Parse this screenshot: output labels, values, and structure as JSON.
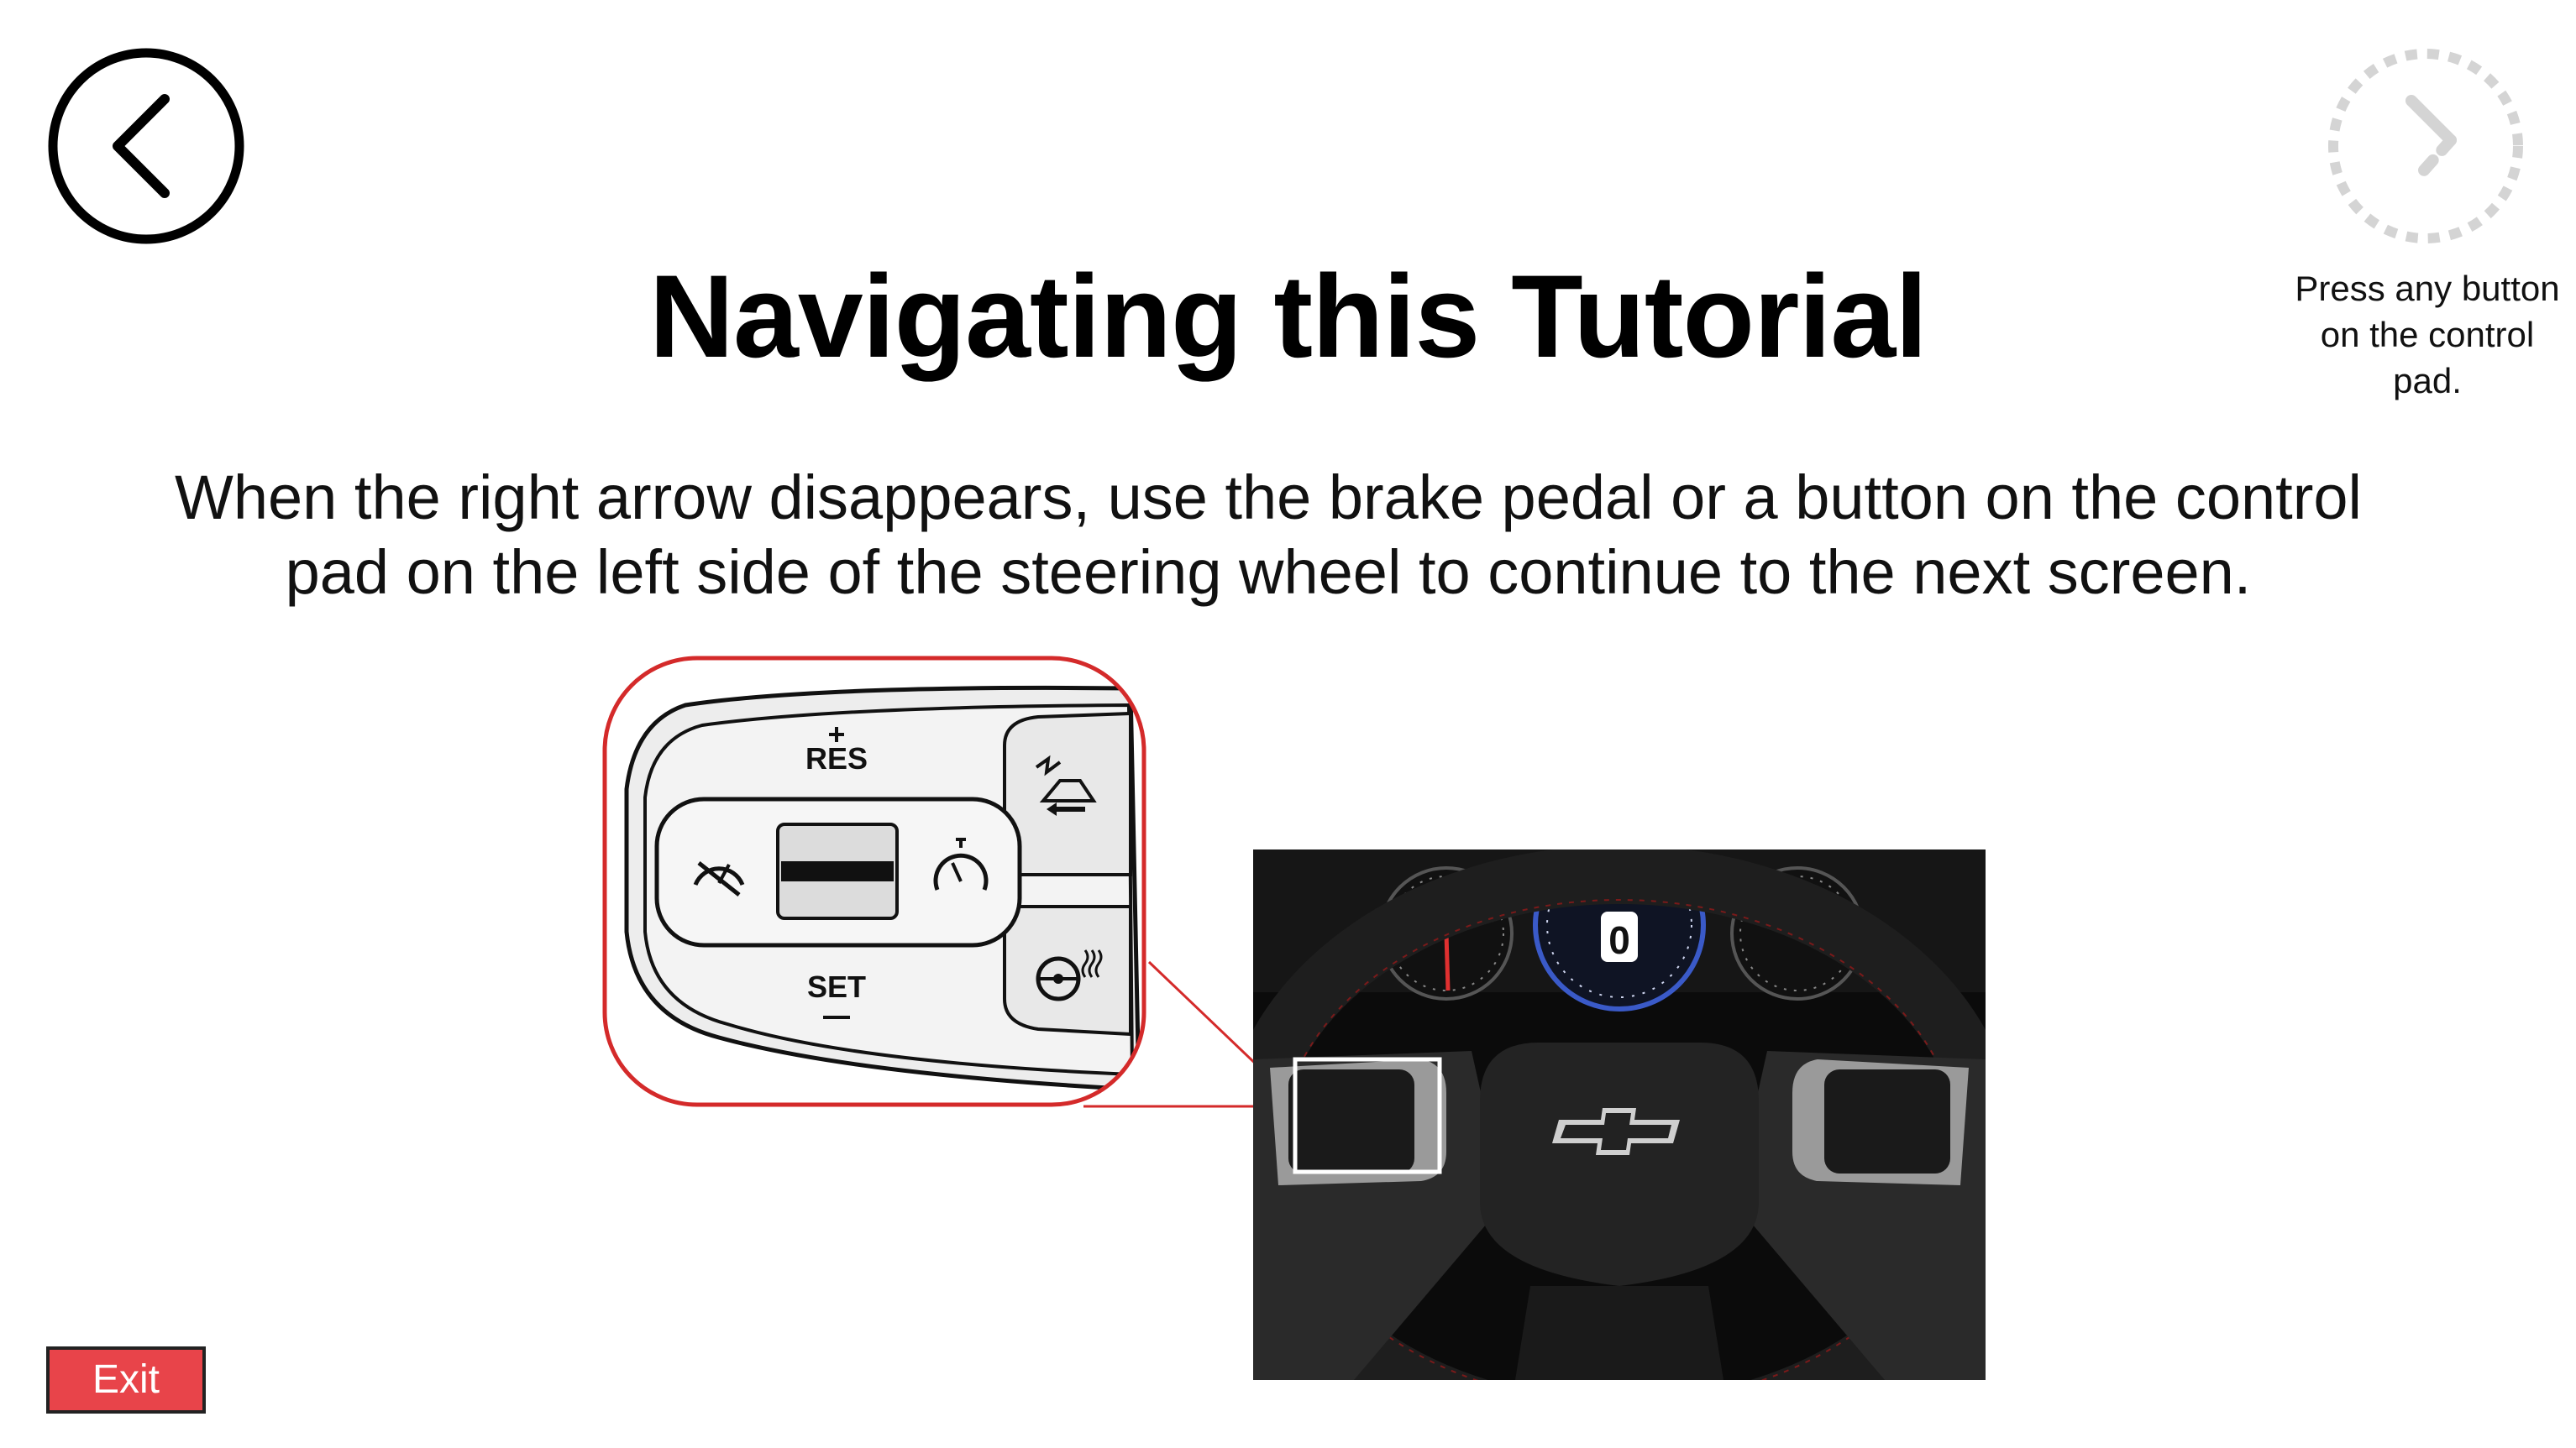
{
  "header": {
    "title": "Navigating this Tutorial"
  },
  "navigation": {
    "back_icon": "chevron-left-icon",
    "next_icon": "chevron-right-icon",
    "next_hint": "Press any button on the control pad."
  },
  "body": {
    "instructions": "When the right arrow disappears, use the brake pedal or a button on the control pad on the left side of the steering wheel to continue to the next screen."
  },
  "diagram": {
    "res_label": "RES",
    "set_label": "SET",
    "highlight_color": "#d42a2a"
  },
  "photo": {
    "speedometer_readout": "0"
  },
  "footer": {
    "exit_label": "Exit",
    "exit_color": "#e8444a"
  }
}
